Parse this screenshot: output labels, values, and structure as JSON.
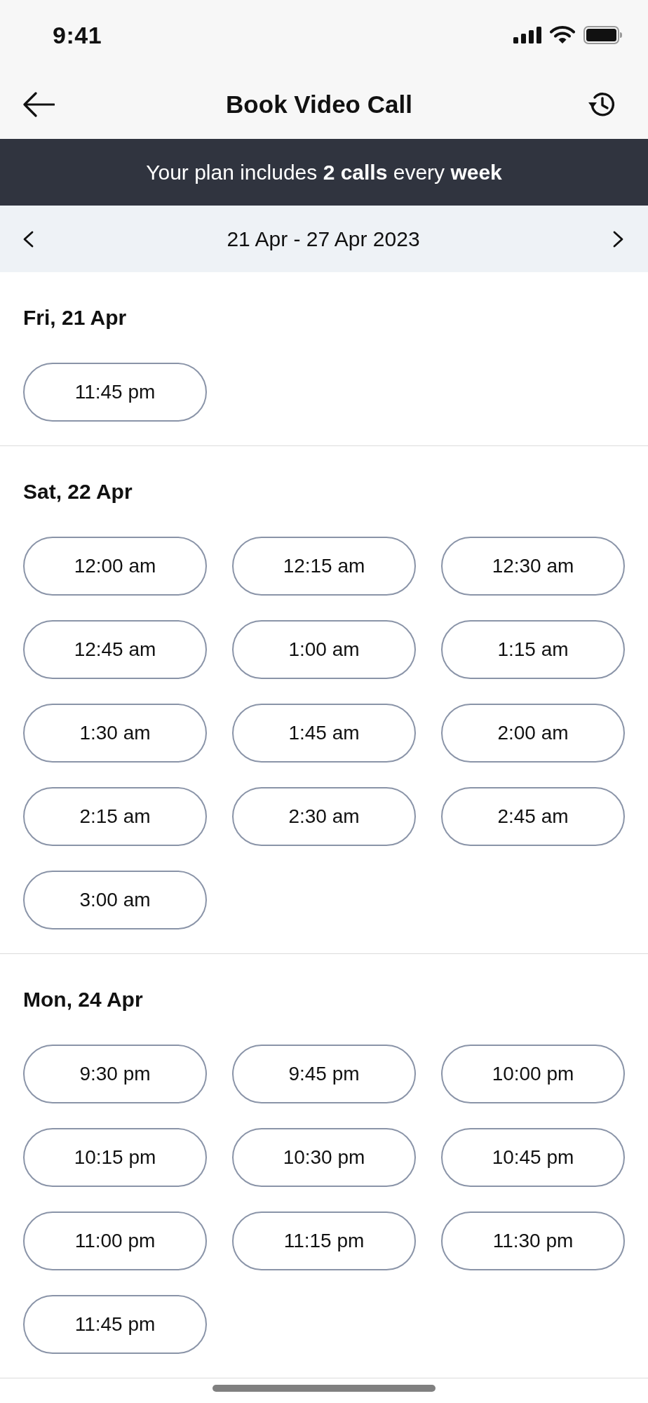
{
  "status_bar": {
    "time": "9:41"
  },
  "header": {
    "title": "Book Video Call"
  },
  "banner": {
    "text": "Your plan includes **2 calls** every **week**"
  },
  "week_nav": {
    "range": "21 Apr - 27 Apr 2023"
  },
  "days": [
    {
      "label": "Fri, 21 Apr",
      "slots": [
        "11:45 pm"
      ]
    },
    {
      "label": "Sat, 22 Apr",
      "slots": [
        "12:00 am",
        "12:15 am",
        "12:30 am",
        "12:45 am",
        "1:00 am",
        "1:15 am",
        "1:30 am",
        "1:45 am",
        "2:00 am",
        "2:15 am",
        "2:30 am",
        "2:45 am",
        "3:00 am"
      ]
    },
    {
      "label": "Mon, 24 Apr",
      "slots": [
        "9:30 pm",
        "9:45 pm",
        "10:00 pm",
        "10:15 pm",
        "10:30 pm",
        "10:45 pm",
        "11:00 pm",
        "11:15 pm",
        "11:30 pm",
        "11:45 pm"
      ]
    }
  ]
}
